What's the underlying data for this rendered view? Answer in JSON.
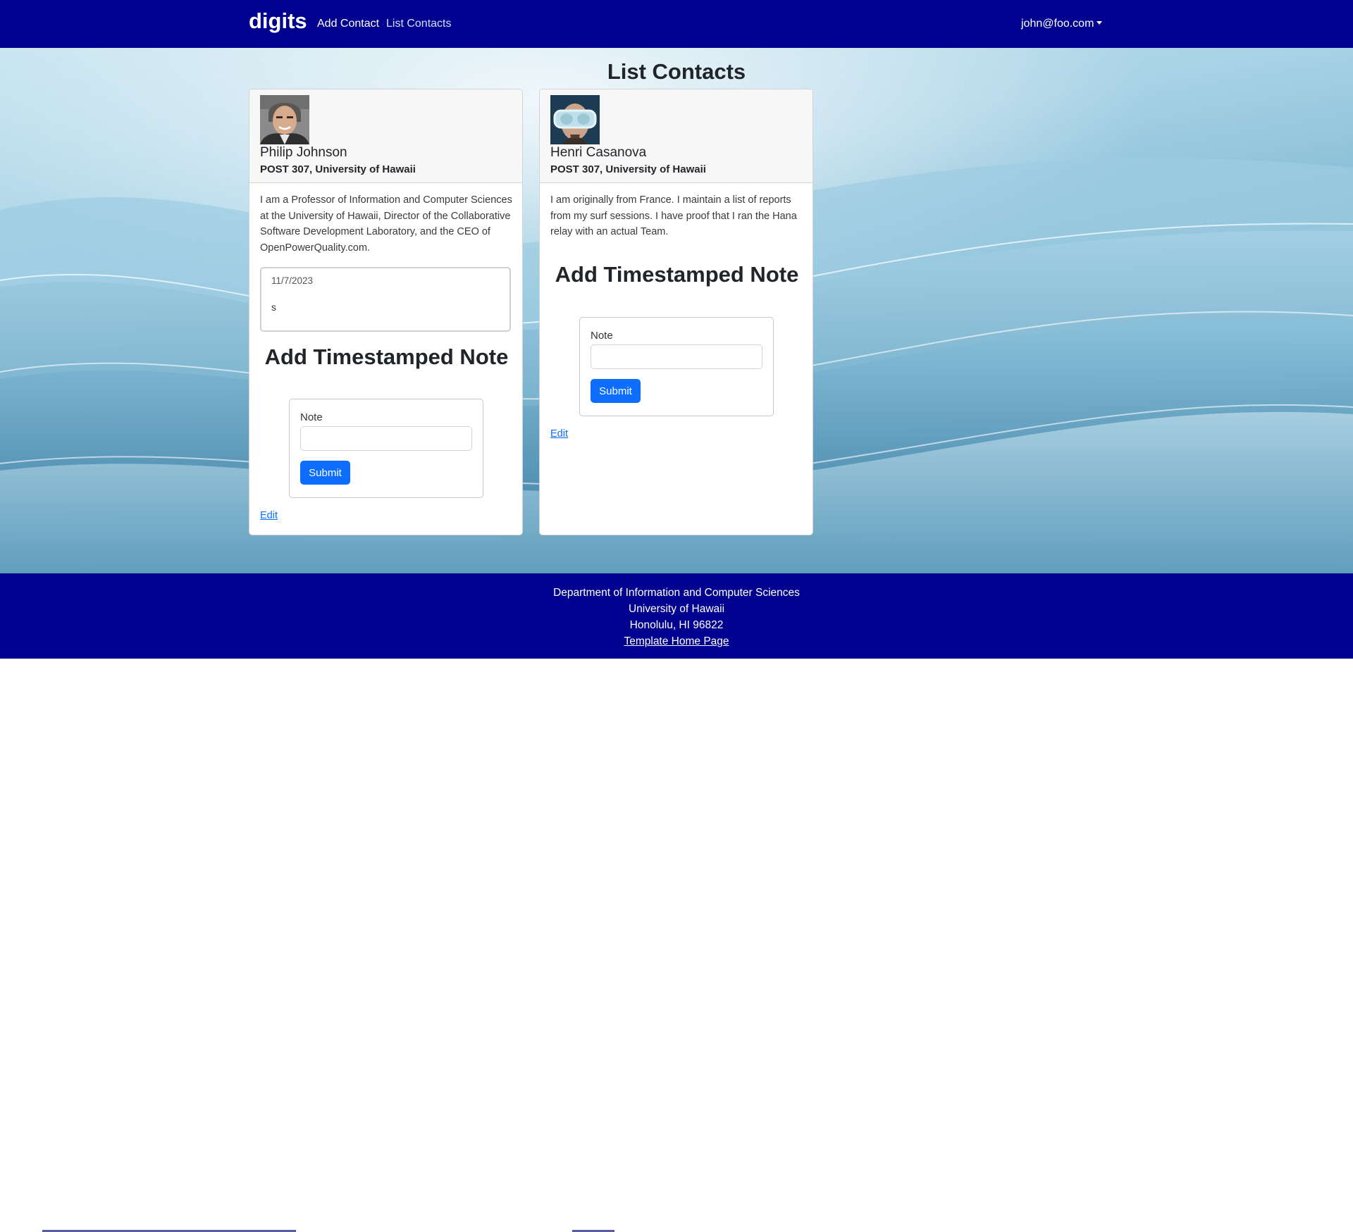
{
  "navbar": {
    "brand": "digits",
    "links": [
      {
        "label": "Add Contact",
        "active": false
      },
      {
        "label": "List Contacts",
        "active": true
      }
    ],
    "user": "john@foo.com"
  },
  "page": {
    "title": "List Contacts"
  },
  "contacts": [
    {
      "name": "Philip Johnson",
      "address": "POST 307, University of Hawaii",
      "description": "I am a Professor of Information and Computer Sciences at the University of Hawaii, Director of the Collaborative Software Development Laboratory, and the CEO of OpenPowerQuality.com.",
      "notes": [
        {
          "date": "11/7/2023",
          "text": "s"
        }
      ],
      "add_note_title": "Add Timestamped Note",
      "note_label": "Note",
      "note_value": "",
      "submit_label": "Submit",
      "edit_label": "Edit"
    },
    {
      "name": "Henri Casanova",
      "address": "POST 307, University of Hawaii",
      "description": "I am originally from France. I maintain a list of reports from my surf sessions. I have proof that I ran the Hana relay with an actual Team.",
      "notes": [],
      "add_note_title": "Add Timestamped Note",
      "note_label": "Note",
      "note_value": "",
      "submit_label": "Submit",
      "edit_label": "Edit"
    }
  ],
  "footer": {
    "lines": [
      "Department of Information and Computer Sciences",
      "University of Hawaii",
      "Honolulu, HI 96822"
    ],
    "link": "Template Home Page"
  },
  "colors": {
    "navbar": "#01018f",
    "primary": "#0d6efd"
  }
}
